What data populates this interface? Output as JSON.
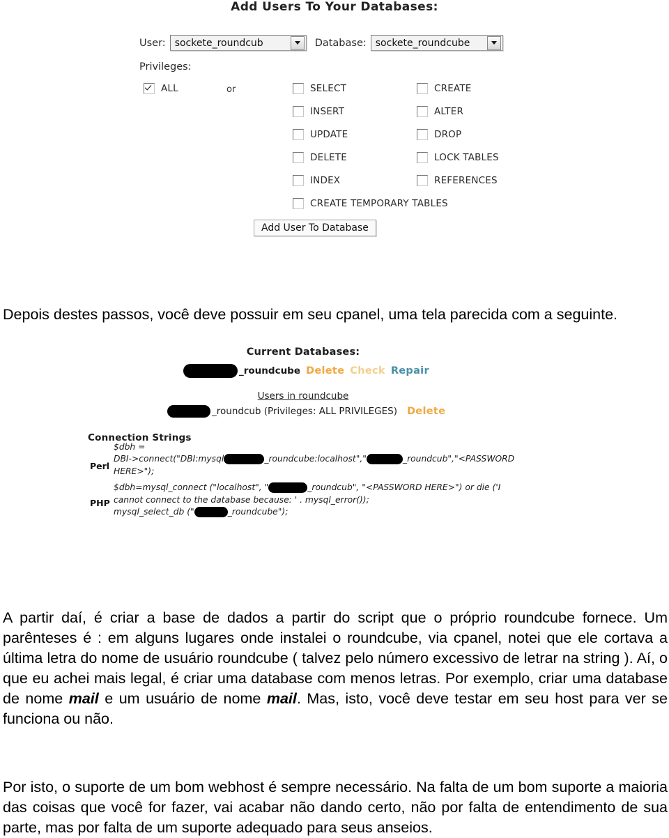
{
  "screenshot_add_users": {
    "title": "Add Users To Your Databases:",
    "user_label": "User:",
    "user_value": "sockete_roundcub",
    "database_label": "Database:",
    "database_value": "sockete_roundcube",
    "privileges_label": "Privileges:",
    "or_label": "or",
    "all_privilege": {
      "label": "ALL",
      "checked": true
    },
    "privileges_col1": [
      {
        "label": "SELECT",
        "checked": false
      },
      {
        "label": "INSERT",
        "checked": false
      },
      {
        "label": "UPDATE",
        "checked": false
      },
      {
        "label": "DELETE",
        "checked": false
      },
      {
        "label": "INDEX",
        "checked": false
      },
      {
        "label": "CREATE TEMPORARY TABLES",
        "checked": false
      }
    ],
    "privileges_col2": [
      {
        "label": "CREATE",
        "checked": false
      },
      {
        "label": "ALTER",
        "checked": false
      },
      {
        "label": "DROP",
        "checked": false
      },
      {
        "label": "LOCK TABLES",
        "checked": false
      },
      {
        "label": "REFERENCES",
        "checked": false
      }
    ],
    "submit_button": "Add User To Database"
  },
  "screenshot_current_databases": {
    "title": "Current Databases:",
    "database_row": {
      "name": "_roundcube",
      "actions": [
        {
          "label": "Delete",
          "color": "#f0a841"
        },
        {
          "label": "Check",
          "color": "#f2cf8e"
        },
        {
          "label": "Repair",
          "color": "#4a8fa8"
        }
      ]
    },
    "users_header": "Users in roundcube",
    "user_row": {
      "text": "_roundcub (Privileges: ALL PRIVILEGES)",
      "action": "Delete"
    },
    "connection_strings": {
      "title": "Connection Strings",
      "perl_label": "Perl",
      "perl_line1": "$dbh =",
      "perl_line2_a": "DBI->connect(\"DBI:mysql",
      "perl_line2_b": "_roundcube:localhost\",\"",
      "perl_line2_c": "_roundcub\",\"<PASSWORD",
      "perl_line3": "HERE>\");",
      "php_label": "PHP",
      "php_line1_a": "$dbh=mysql_connect (\"localhost\", \"",
      "php_line1_b": "_roundcub\", \"<PASSWORD HERE>\") or die ('I",
      "php_line2": "cannot connect to the database because: ' . mysql_error());",
      "php_line3_a": "mysql_select_db (\"",
      "php_line3_b": "_roundcube\");"
    }
  },
  "body": {
    "paragraph_intro": "Depois destes passos, você deve possuir em seu cpanel, uma tela parecida com a seguinte.",
    "paragraph_middle_part1": "A partir daí, é criar a base de dados a partir do script que o próprio roundcube fornece. Um parênteses é : em alguns lugares onde instalei o roundcube, via cpanel, notei que ele cortava a última letra do nome de usuário roundcube ( talvez pelo número excessivo de letrar na string ). Aí, o que eu achei mais legal, é criar uma database com menos letras. Por exemplo, criar uma database de nome ",
    "paragraph_middle_bold1": "mail",
    "paragraph_middle_part2": " e um usuário de nome ",
    "paragraph_middle_bold2": "mail",
    "paragraph_middle_part3": ". Mas, isto, você deve testar em seu host para ver se funciona ou não.",
    "paragraph_end": "Por isto, o suporte de um bom webhost é sempre necessário. Na falta de um bom suporte a maioria das coisas que você for fazer, vai acabar não dando certo, não por falta de entendimento de sua parte, mas por falta de um suporte adequado para seus anseios."
  }
}
